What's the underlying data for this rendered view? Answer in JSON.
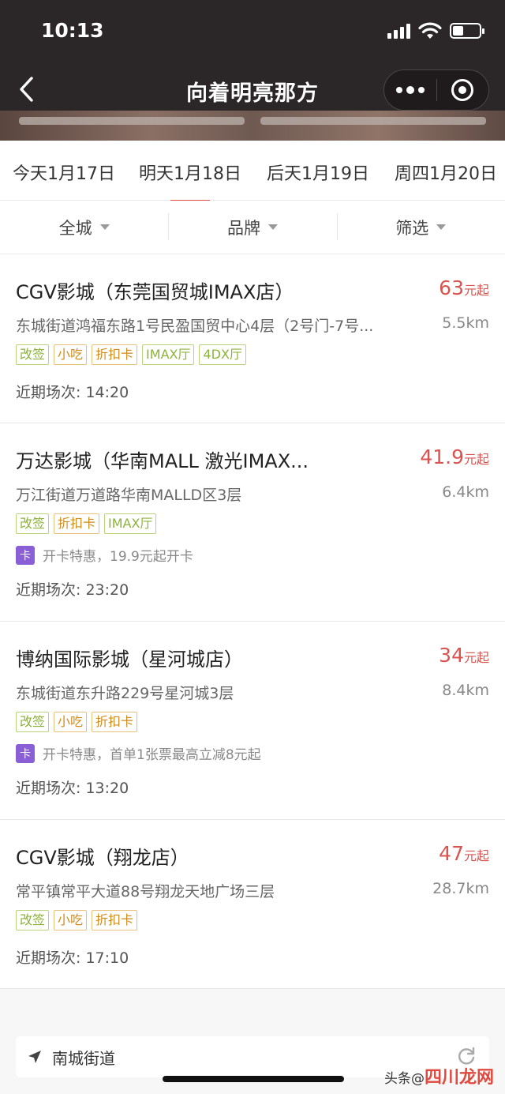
{
  "status_bar": {
    "time": "10:13",
    "battery_level": 0.4
  },
  "nav": {
    "title": "向着明亮那方"
  },
  "date_tabs": [
    {
      "label": "今天1月17日",
      "active": false
    },
    {
      "label": "明天1月18日",
      "active": true
    },
    {
      "label": "后天1月19日",
      "active": false
    },
    {
      "label": "周四1月20日",
      "active": false
    }
  ],
  "filters": [
    "全城",
    "品牌",
    "筛选"
  ],
  "cinemas": [
    {
      "name": "CGV影城（东莞国贸城IMAX店）",
      "price": "63",
      "price_unit": "元起",
      "address": "东城街道鸿福东路1号民盈国贸中心4层（2号门-7号...",
      "distance": "5.5km",
      "tags": [
        "改签",
        "小吃",
        "折扣卡",
        "IMAX厅",
        "4DX厅"
      ],
      "promo": null,
      "session": "近期场次: 14:20"
    },
    {
      "name": "万达影城（华南MALL 激光IMAX...",
      "price": "41.9",
      "price_unit": "元起",
      "address": "万江街道万道路华南MALLD区3层",
      "distance": "6.4km",
      "tags": [
        "改签",
        "折扣卡",
        "IMAX厅"
      ],
      "promo": {
        "icon": "卡",
        "text": "开卡特惠，19.9元起开卡"
      },
      "session": "近期场次: 23:20"
    },
    {
      "name": "博纳国际影城（星河城店）",
      "price": "34",
      "price_unit": "元起",
      "address": "东城街道东升路229号星河城3层",
      "distance": "8.4km",
      "tags": [
        "改签",
        "小吃",
        "折扣卡"
      ],
      "promo": {
        "icon": "卡",
        "text": "开卡特惠，首单1张票最高立减8元起"
      },
      "session": "近期场次: 13:20"
    },
    {
      "name": "CGV影城（翔龙店）",
      "price": "47",
      "price_unit": "元起",
      "address": "常平镇常平大道88号翔龙天地广场三层",
      "distance": "28.7km",
      "tags": [
        "改签",
        "小吃",
        "折扣卡"
      ],
      "promo": null,
      "session": "近期场次: 17:10"
    }
  ],
  "location": {
    "text": "南城街道"
  },
  "watermark": {
    "prefix": "头条",
    "middle": "@",
    "brand": "四川龙网"
  },
  "colors": {
    "accent": "#e54d42",
    "price": "#d9534f",
    "tag_green": "#8cb33a",
    "tag_orange": "#d08b1c",
    "card_purple": "#8a5fd6"
  }
}
